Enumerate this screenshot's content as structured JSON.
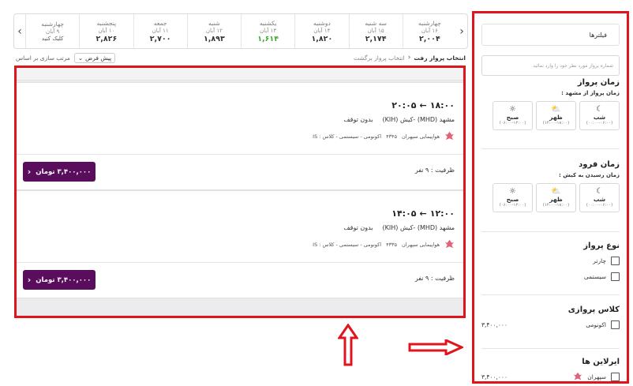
{
  "days": {
    "items": [
      {
        "name": "چهارشنبه",
        "date": "۹ آبان",
        "price": "",
        "sub": "کلیک کنید",
        "green": false
      },
      {
        "name": "پنجشنبه",
        "date": "۱۰ آبان",
        "price": "۲,۸۲۶",
        "sub": "",
        "green": false
      },
      {
        "name": "جمعه",
        "date": "۱۱ آبان",
        "price": "۲,۷۰۰",
        "sub": "",
        "green": false
      },
      {
        "name": "شنبه",
        "date": "۱۲ آبان",
        "price": "۱,۸۹۳",
        "sub": "",
        "green": false
      },
      {
        "name": "یکشنبه",
        "date": "۱۳ آبان",
        "price": "۱,۶۱۴",
        "sub": "",
        "green": true
      },
      {
        "name": "دوشنبه",
        "date": "۱۴ آبان",
        "price": "۱,۸۲۰",
        "sub": "",
        "green": false
      },
      {
        "name": "سه شنبه",
        "date": "۱۵ آبان",
        "price": "۲,۱۷۴",
        "sub": "",
        "green": false
      },
      {
        "name": "چهارشنبه",
        "date": "۱۶ آبان",
        "price": "۲,۰۰۴",
        "sub": "",
        "green": false
      }
    ]
  },
  "sortbar": {
    "label": "مرتب سازی بر اساس",
    "selected": "پیش فرض",
    "crumb_active": "انتخاب پرواز رفت",
    "crumb_link": "انتخاب پرواز برگشت"
  },
  "flights": [
    {
      "depart": "۱۸:۰۰",
      "arrive": "۲۰:۰۵",
      "route": "مشهد (MHD) -کیش (KIH)",
      "stops": "بدون توقف",
      "airline": "هواپیمایی سپهران",
      "flight_no": "۴۳۴۵",
      "cabin": "اکونومی - سیستمی - کلاس : IS",
      "capacity": "ظرفیت : ۹ نفر",
      "price": "۳,۴۰۰,۰۰۰ تومان"
    },
    {
      "depart": "۱۲:۰۰",
      "arrive": "۱۴:۰۵",
      "route": "مشهد (MHD) -کیش (KIH)",
      "stops": "بدون توقف",
      "airline": "هواپیمایی سپهران",
      "flight_no": "۴۳۳۵",
      "cabin": "اکونومی - سیستمی - کلاس : IS",
      "capacity": "ظرفیت : ۹ نفر",
      "price": "۳,۴۰۰,۰۰۰ تومان"
    }
  ],
  "filters": {
    "header": "فیلترها",
    "search_placeholder": "شماره پرواز مورد نظر خود را وارد نمائید",
    "departure": {
      "title": "زمان پرواز",
      "sub": "زمان پرواز از مشهد :",
      "options": [
        {
          "name": "شب",
          "range": "(۰۰:۰۰-۰۶:۰۰)",
          "icon": "moon-icon"
        },
        {
          "name": "ظهر",
          "range": "(۱۲:۰۰-۱۸:۰۰)",
          "icon": "sun-cloud-icon"
        },
        {
          "name": "صبح",
          "range": "(۰۶:۰۰-۱۲:۰۰)",
          "icon": "sun-icon"
        }
      ]
    },
    "arrival": {
      "title": "زمان فرود",
      "sub": "زمان رسیدن به کیش :",
      "options": [
        {
          "name": "شب",
          "range": "(۰۰:۰۰-۰۶:۰۰)",
          "icon": "moon-icon"
        },
        {
          "name": "ظهر",
          "range": "(۱۲:۰۰-۱۸:۰۰)",
          "icon": "sun-cloud-icon"
        },
        {
          "name": "صبح",
          "range": "(۰۶:۰۰-۱۲:۰۰)",
          "icon": "sun-icon"
        }
      ]
    },
    "flight_type": {
      "title": "نوع پرواز",
      "options": [
        "چارتر",
        "سیستمی"
      ]
    },
    "flight_class": {
      "title": "کلاس پروازی",
      "option": "اکونومی",
      "price": "۳,۴۰۰,۰۰۰"
    },
    "airlines": {
      "title": "ایرلاین ها",
      "option": "سپهران",
      "price": "۳,۴۰۰,۰۰۰"
    }
  },
  "colors": {
    "accent": "#5a0d5c",
    "highlight": "#e0141c",
    "cheapest": "#3caa2f"
  }
}
